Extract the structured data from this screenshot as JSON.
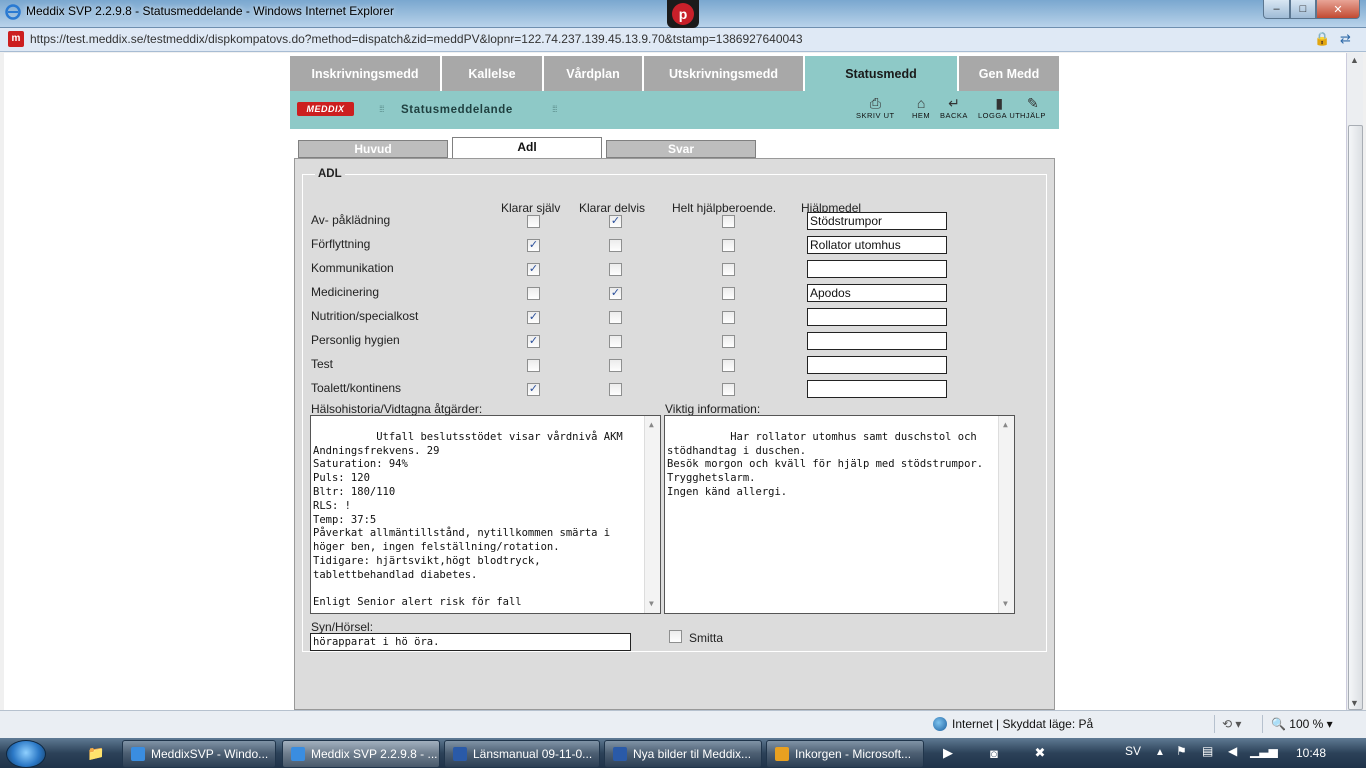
{
  "window": {
    "title": "Meddix SVP 2.2.9.8 - Statusmeddelande - Windows Internet Explorer",
    "minimize": "‒",
    "maximize": "□",
    "close": "✕"
  },
  "address": {
    "url": "https://test.meddix.se/testmeddix/dispkompatovs.do?method=dispatch&zid=meddPV&lopnr=122.74.237.139.45.13.9.70&tstamp=1386927640043"
  },
  "nav_tabs": [
    {
      "label": "Inskrivningsmedd",
      "active": false
    },
    {
      "label": "Kallelse",
      "active": false
    },
    {
      "label": "Vårdplan",
      "active": false
    },
    {
      "label": "Utskrivningsmedd",
      "active": false
    },
    {
      "label": "Statusmedd",
      "active": true
    },
    {
      "label": "Gen Medd",
      "active": false
    }
  ],
  "header": {
    "logo_text": "MEDDIX",
    "title": "Statusmeddelande",
    "tools": [
      {
        "label": "SKRIV UT",
        "icon": "printer-icon"
      },
      {
        "label": "HEM",
        "icon": "home-icon"
      },
      {
        "label": "BACKA",
        "icon": "back-icon"
      },
      {
        "label": "LOGGA UT",
        "icon": "logout-icon"
      },
      {
        "label": "HJÄLP",
        "icon": "help-icon"
      }
    ]
  },
  "sub_tabs": [
    {
      "label": "Huvud",
      "active": false
    },
    {
      "label": "Adl",
      "active": true
    },
    {
      "label": "Svar",
      "active": false
    }
  ],
  "adl": {
    "legend": "ADL",
    "columns": {
      "self": "Klarar själv",
      "partial": "Klarar delvis",
      "dependent": "Helt hjälpberoende.",
      "aid": "Hjälpmedel"
    },
    "rows": [
      {
        "label": "Av- påklädning",
        "self": false,
        "partial": true,
        "dependent": false,
        "aid": "Stödstrumpor"
      },
      {
        "label": "Förflyttning",
        "self": true,
        "partial": false,
        "dependent": false,
        "aid": "Rollator utomhus"
      },
      {
        "label": "Kommunikation",
        "self": true,
        "partial": false,
        "dependent": false,
        "aid": ""
      },
      {
        "label": "Medicinering",
        "self": false,
        "partial": true,
        "dependent": false,
        "aid": "Apodos"
      },
      {
        "label": "Nutrition/specialkost",
        "self": true,
        "partial": false,
        "dependent": false,
        "aid": ""
      },
      {
        "label": "Personlig hygien",
        "self": true,
        "partial": false,
        "dependent": false,
        "aid": ""
      },
      {
        "label": "Test",
        "self": false,
        "partial": false,
        "dependent": false,
        "aid": ""
      },
      {
        "label": "Toalett/kontinens",
        "self": true,
        "partial": false,
        "dependent": false,
        "aid": ""
      }
    ],
    "health_history_label": "Hälsohistoria/Vidtagna åtgärder:",
    "health_history": "Utfall beslutsstödet visar vårdnivå AKM\nAndningsfrekvens. 29\nSaturation: 94%\nPuls: 120\nBltr: 180/110\nRLS: !\nTemp: 37:5\nPåverkat allmäntillstånd, nytillkommen smärta i höger ben, ingen felställning/rotation.\nTidigare: hjärtsvikt,högt blodtryck, tablettbehandlad diabetes.\n\nEnligt Senior alert risk för fall",
    "important_label": "Viktig information:",
    "important": "Har rollator utomhus samt duschstol och stödhandtag i duschen.\nBesök morgon och kväll för hjälp med stödstrumpor.\nTrygghetslarm.\nIngen känd allergi.",
    "vision_label": "Syn/Hörsel:",
    "vision": "hörapparat i hö öra.",
    "smitta_label": "Smitta",
    "smitta": false
  },
  "statusbar": {
    "zone": "Internet | Skyddat läge: På",
    "zoom": "100 %"
  },
  "taskbar": {
    "tasks": [
      {
        "label": "MeddixSVP - Windo...",
        "active": false,
        "color": "#3a8de0"
      },
      {
        "label": "Meddix SVP 2.2.9.8 - ...",
        "active": true,
        "color": "#3a8de0"
      },
      {
        "label": "Länsmanual 09-11-0...",
        "active": false,
        "color": "#2a5aa8"
      },
      {
        "label": "Nya bilder til Meddix...",
        "active": false,
        "color": "#2a5aa8"
      },
      {
        "label": "Inkorgen - Microsoft...",
        "active": false,
        "color": "#e8a020"
      }
    ],
    "language": "SV",
    "clock": "10:48"
  }
}
